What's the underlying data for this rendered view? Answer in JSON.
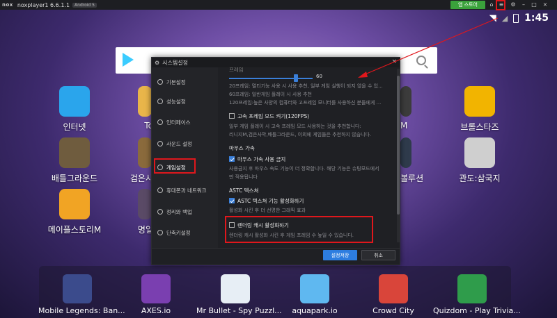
{
  "titlebar": {
    "logo": "nox",
    "title": "noxplayer1 6.6.1.1",
    "android_badge": "Android 5",
    "store_label": "앱 스토어"
  },
  "status": {
    "time": "1:45"
  },
  "apps": [
    {
      "label": "인터넷",
      "color": "#2aa5ec"
    },
    {
      "label": "배틀그라운드",
      "color": "#6f5c3e"
    },
    {
      "label": "메이플스토리M",
      "color": "#f1a424"
    },
    {
      "label": "To",
      "color": "#e9b54a"
    },
    {
      "label": "검은사",
      "color": "#8a6a3c"
    },
    {
      "label": "명일",
      "color": "#5a4a66"
    },
    {
      "label": "M",
      "color": "#3c3c3c"
    },
    {
      "label": "볼루션",
      "color": "#2f3b4c"
    },
    {
      "label": "브롤스타즈",
      "color": "#f2b400"
    },
    {
      "label": "관도:삼국지",
      "color": "#cfcfcf"
    }
  ],
  "dock": [
    {
      "label": "Mobile Legends: Ban...",
      "color": "#3b4b8c"
    },
    {
      "label": "AXES.io",
      "color": "#7a3fb0"
    },
    {
      "label": "Mr Bullet - Spy Puzzl...",
      "color": "#e7eef5"
    },
    {
      "label": "aquapark.io",
      "color": "#5fb8f0"
    },
    {
      "label": "Crowd City",
      "color": "#d9453a"
    },
    {
      "label": "Quizdom - Play Trivia...",
      "color": "#2f9c4b"
    }
  ],
  "dialog": {
    "title": "시스템설정",
    "sidebar": [
      "기본설정",
      "성능설정",
      "인터페이스",
      "사운드 설정",
      "게임설정",
      "휴대폰과 네트워크",
      "정리와 백업",
      "단축키설정"
    ],
    "frame_label": "프레임",
    "slider_value": "60",
    "frame_desc_1": "20프레임: 멀티기능 사용 시 사용 추천, 일부 게임 실행이 되지 않을 수 있...",
    "frame_desc_2": "60프레임: 일반게임 플레이 시 사용 추천",
    "frame_desc_3": "120프레임:높은 사양의 컴퓨터와 고프레임 모니터를 사용하신 분들에게 ...",
    "high_fps_label": "고속 프레임 모드 켜기(120FPS)",
    "high_fps_desc_1": "일부 게임 플레이 시 고속 프레임 모드 사용하는 것을 추천합니다:",
    "high_fps_desc_2": "리니지M,검은사막,배틀그라운드, 이외에 게임들은 추천하지 않습니다.",
    "mouse_heading": "마우스 가속",
    "mouse_label": "마우스 가속 사용 금지",
    "mouse_desc_1": "사용금지 후 마우스 속도 기능이 더 정확합니다. 해당 기능은 슈팅모드에서",
    "mouse_desc_2": "만 적용됩니다",
    "astc_heading": "ASTC 텍스쳐",
    "astc_label": "ASTC 텍스쳐 기능 활성화하기",
    "astc_desc": "활성화 시킨 후 더 선명한 그래픽 효과",
    "cache_label": "렌더링 캐시 활성화하기",
    "cache_desc": "렌더링 캐시 활성화 시킨 후 게임 프레임 수 높일 수 있습니다.",
    "save_label": "설정저장",
    "cancel_label": "취소"
  }
}
